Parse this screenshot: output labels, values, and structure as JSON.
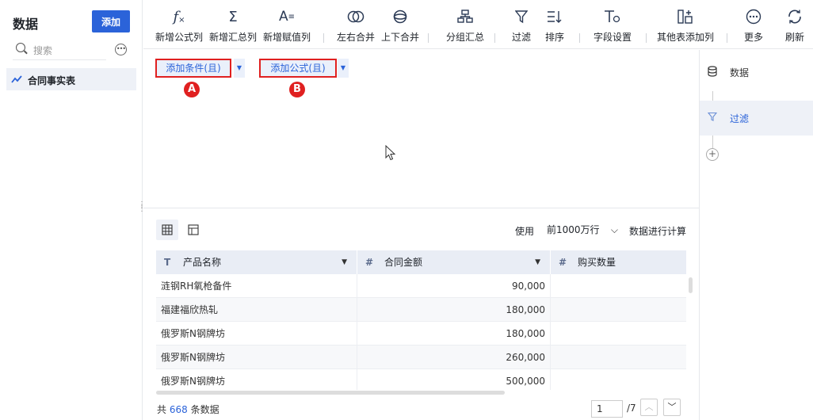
{
  "sidebar": {
    "title": "数据",
    "add_label": "添加",
    "search_placeholder": "搜索",
    "item": "合同事实表"
  },
  "toolbar": [
    {
      "label": "新增公式列",
      "icon": "formula-icon"
    },
    {
      "label": "新增汇总列",
      "icon": "sigma-icon"
    },
    {
      "label": "新增赋值列",
      "icon": "assign-icon"
    },
    {
      "label": "左右合并",
      "icon": "merge-horizontal-icon"
    },
    {
      "label": "上下合并",
      "icon": "merge-vertical-icon"
    },
    {
      "label": "分组汇总",
      "icon": "group-icon"
    },
    {
      "label": "过滤",
      "icon": "filter-icon"
    },
    {
      "label": "排序",
      "icon": "sort-icon"
    },
    {
      "label": "字段设置",
      "icon": "field-settings-icon"
    },
    {
      "label": "其他表添加列",
      "icon": "add-column-icon"
    },
    {
      "label": "更多",
      "icon": "more-icon"
    },
    {
      "label": "刷新",
      "icon": "refresh-icon"
    }
  ],
  "filter": {
    "add_condition": "添加条件(且)",
    "add_formula": "添加公式(且)",
    "marker_a": "A",
    "marker_b": "B"
  },
  "steps": [
    {
      "label": "数据",
      "icon": "database-icon"
    },
    {
      "label": "过滤",
      "icon": "filter-icon"
    }
  ],
  "preview": {
    "use_label": "使用",
    "rows_option": "前1000万行",
    "calc_label": "数据进行计算",
    "columns": [
      {
        "type_glyph": "T",
        "name": "产品名称"
      },
      {
        "type_glyph": "#",
        "name": "合同金额"
      },
      {
        "type_glyph": "#",
        "name": "购买数量"
      }
    ],
    "rows": [
      [
        "涟钢RH氧枪备件",
        "90,000",
        ""
      ],
      [
        "福建福欣热轧",
        "180,000",
        ""
      ],
      [
        "俄罗斯N钢牌坊",
        "180,000",
        ""
      ],
      [
        "俄罗斯N钢牌坊",
        "260,000",
        ""
      ],
      [
        "俄罗斯N钢牌坊",
        "500,000",
        ""
      ]
    ],
    "total_prefix": "共",
    "total_count": "668",
    "total_suffix": "条数据",
    "page_current": "1",
    "page_total": "/7"
  },
  "colors": {
    "accent": "#2b63d9",
    "highlight": "#e02020",
    "header_bg": "#e9edf5"
  }
}
